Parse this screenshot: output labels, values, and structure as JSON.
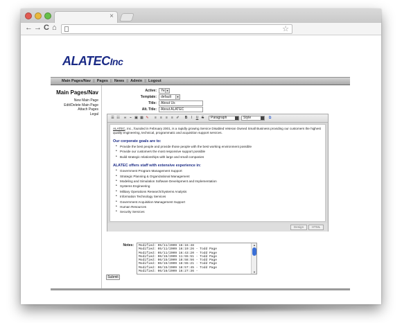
{
  "browser": {
    "tab_close": "×",
    "nav_back": "←",
    "nav_forward": "→",
    "reload": "C",
    "home": "⌂",
    "bookmark": "☆"
  },
  "logo": {
    "text": "ALATEC",
    "suffix": "Inc"
  },
  "menu": {
    "items": [
      "Main Pages/Nav",
      "Pages",
      "News",
      "Admin",
      "Logout"
    ],
    "separator": "||"
  },
  "sidebar": {
    "title": "Main Pages/Nav",
    "links": [
      "New Main Page",
      "Edit/Delete Main Page",
      "Attach Pages",
      "Legal"
    ]
  },
  "form": {
    "active_label": "Active:",
    "active_value": "Yes",
    "template_label": "Template:",
    "template_value": "default",
    "title_label": "Title:",
    "title_value": "About Us",
    "alt_title_label": "Alt. Title:",
    "alt_title_value": "About ALATEC"
  },
  "editor": {
    "format_select": "Paragraph",
    "style_select": "Style",
    "toolbar_letters": {
      "bold": "B",
      "italic": "I",
      "underline": "U",
      "strike": "S"
    },
    "intro_link": "ALATEC",
    "intro_text": ", Inc., founded in February 2001, is a rapidly growing Service Disabled Veteran Owned Small Business providing our customers the highest quality engineering, technical, programmatic and acquisition support services.",
    "goals_heading": "Our corporate goals are to:",
    "goals": [
      "Provide the best people and provide those people with the best working environment possible",
      "Provide our customers the most responsive support possible",
      "Build strategic relationships with large and small companies"
    ],
    "experience_heading": "ALATEC offers staff with extensive experience in:",
    "experience": [
      "Government Program Management Support",
      "Strategic Planning & Organizational Management",
      "Modeling and Simulation Software Development and Implementation",
      "Systems Engineering",
      "Military Operations Research/Systems Analysis",
      "Information Technology Services",
      "Government Acquisition Management Support",
      "Human Resources",
      "Security Services"
    ],
    "design_button": "Design",
    "html_button": "HTML"
  },
  "notes": {
    "label": "Notes:",
    "lines": [
      "Modified: 05/11/2009 16:16:48",
      "Modified: 05/11/2009 16:19:26 - Todd Page",
      "Modified: 05/11/2009 16:43:20 - Todd Page",
      "Modified: 06/15/2009 11:55:51 - Todd Page",
      "Modified: 06/15/2009 18:58:56 - Todd Page",
      "Modified: 06/15/2009 18:55:21 - Todd Page",
      "Modified: 06/15/2009 18:57:45 - Todd Page",
      "Modified: 06/16/2009 16:27:36 -"
    ]
  },
  "submit_label": "Submit"
}
